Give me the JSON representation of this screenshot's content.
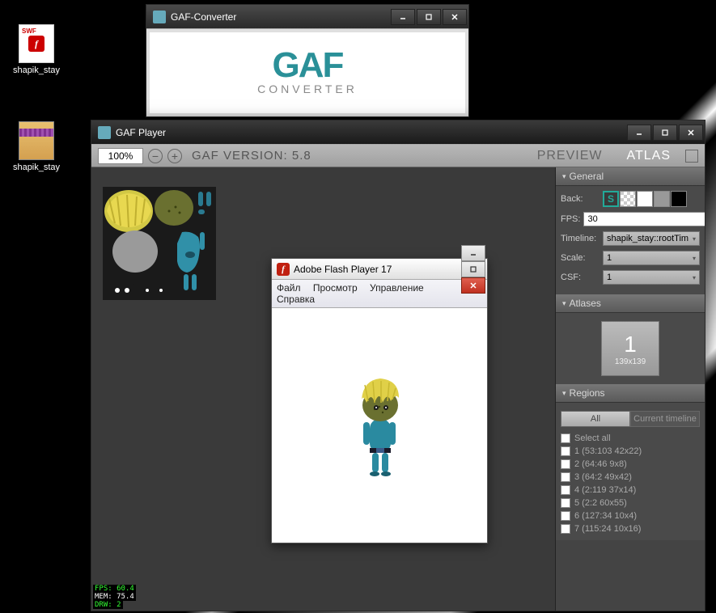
{
  "desktop": {
    "icon_swf": {
      "label": "shapik_stay"
    },
    "icon_rar": {
      "label": "shapik_stay"
    }
  },
  "gaf_converter": {
    "title": "GAF-Converter",
    "logo_main": "GAF",
    "logo_sub": "CONVERTER"
  },
  "gaf_player": {
    "title": "GAF Player",
    "zoom": "100%",
    "version_label": "GAF VERSION: 5.8",
    "tab_preview": "PREVIEW",
    "tab_atlas": "ATLAS",
    "stats": {
      "fps": "FPS: 60.4",
      "mem": "MEM: 75.4",
      "drw": "DRW: 2"
    },
    "panels": {
      "general": {
        "header": "General",
        "back_label": "Back:",
        "fps_label": "FPS:",
        "fps_value": "30",
        "timeline_label": "Timeline:",
        "timeline_value": "shapik_stay::rootTim",
        "scale_label": "Scale:",
        "scale_value": "1",
        "csf_label": "CSF:",
        "csf_value": "1",
        "swatches": [
          "#3a3a3a",
          "trans",
          "#ffffff",
          "#999999",
          "#000000"
        ]
      },
      "atlases": {
        "header": "Atlases",
        "thumb_index": "1",
        "thumb_dim": "139x139"
      },
      "regions": {
        "header": "Regions",
        "tab_all": "All",
        "tab_current": "Current timeline",
        "select_all": "Select all",
        "items": [
          "1  (53:103  42x22)",
          "2  (64:46  9x8)",
          "3  (64:2  49x42)",
          "4  (2:119  37x14)",
          "5  (2:2  60x55)",
          "6  (127:34  10x4)",
          "7  (115:24  10x16)"
        ]
      }
    }
  },
  "flash": {
    "title": "Adobe Flash Player 17",
    "menu": {
      "file": "Файл",
      "view": "Просмотр",
      "control": "Управление",
      "help": "Справка"
    }
  }
}
